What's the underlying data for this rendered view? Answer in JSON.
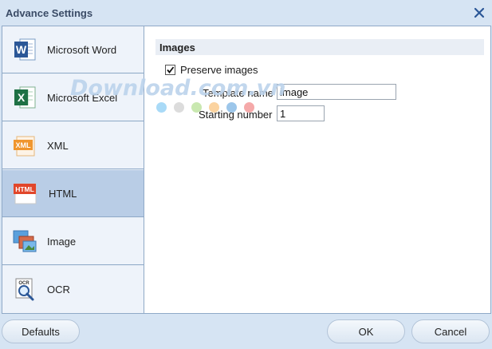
{
  "window": {
    "title": "Advance Settings"
  },
  "sidebar": {
    "items": [
      {
        "label": "Microsoft Word",
        "icon": "word-icon",
        "active": false
      },
      {
        "label": "Microsoft Excel",
        "icon": "excel-icon",
        "active": false
      },
      {
        "label": "XML",
        "icon": "xml-icon",
        "active": false
      },
      {
        "label": "HTML",
        "icon": "html-icon",
        "active": true
      },
      {
        "label": "Image",
        "icon": "image-icon",
        "active": false
      },
      {
        "label": "OCR",
        "icon": "ocr-icon",
        "active": false
      }
    ]
  },
  "content": {
    "section_title": "Images",
    "preserve_images": {
      "label": "Preserve images",
      "checked": true
    },
    "template_name": {
      "label": "Template name",
      "value": "image"
    },
    "starting_number": {
      "label": "Starting number",
      "value": "1"
    }
  },
  "watermark": {
    "text": "Download.com.vn"
  },
  "buttons": {
    "defaults": "Defaults",
    "ok": "OK",
    "cancel": "Cancel"
  },
  "colors": {
    "window_bg": "#d6e4f3",
    "active_item": "#b9cde6",
    "word_blue": "#2b5797",
    "excel_green": "#1e7145",
    "html_red": "#e1462a",
    "xml_orange": "#f0962e"
  }
}
